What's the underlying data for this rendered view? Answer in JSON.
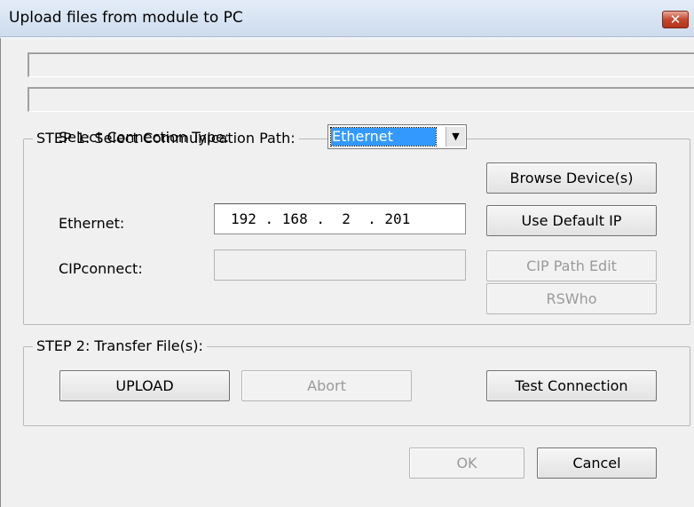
{
  "window": {
    "title": "Upload files from module to PC",
    "close_glyph": "✕"
  },
  "step1": {
    "legend": "STEP 1: Select Communication Path:",
    "connection_type_label": "Select Connection Type:",
    "connection_type_value": "Ethernet",
    "ethernet_label": "Ethernet:",
    "ip_address": "192 . 168 .  2  . 201",
    "cipconnect_label": "CIPconnect:",
    "cipconnect_value": "",
    "browse_button": "Browse Device(s)",
    "default_ip_button": "Use Default IP",
    "cip_path_button": "CIP Path Edit",
    "rswho_button": "RSWho"
  },
  "step2": {
    "legend": "STEP 2: Transfer File(s):",
    "upload_button": "UPLOAD",
    "abort_button": "Abort",
    "test_button": "Test Connection"
  },
  "footer": {
    "ok_button": "OK",
    "cancel_button": "Cancel"
  },
  "icons": {
    "dropdown": "chevron-down-icon",
    "close": "close-icon"
  },
  "colors": {
    "selection": "#3399ff",
    "close": "#c4472f"
  }
}
